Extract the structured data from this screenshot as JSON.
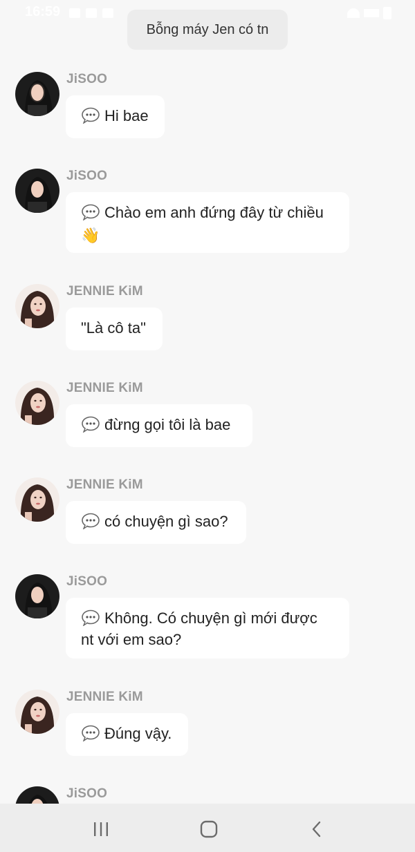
{
  "status_bar": {
    "time": "16:59"
  },
  "chat": {
    "title": "Bỗng máy Jen có tn"
  },
  "messages": [
    {
      "sender": "JiSOO",
      "text": "Hi bae",
      "typing_icon": true,
      "emoji": ""
    },
    {
      "sender": "JiSOO",
      "text": "Chào em anh đứng đây từ chiều",
      "typing_icon": true,
      "emoji": "👋"
    },
    {
      "sender": "JENNIE KiM",
      "text": "\"Là cô ta\"",
      "typing_icon": false,
      "emoji": ""
    },
    {
      "sender": "JENNIE KiM",
      "text": "đừng gọi tôi là bae",
      "typing_icon": true,
      "emoji": ""
    },
    {
      "sender": "JENNIE KiM",
      "text": "có chuyện gì sao?",
      "typing_icon": true,
      "emoji": ""
    },
    {
      "sender": "JiSOO",
      "text": "Không. Có chuyện gì mới được nt với em sao?",
      "typing_icon": true,
      "emoji": ""
    },
    {
      "sender": "JENNIE KiM",
      "text": "Đúng vậy.",
      "typing_icon": true,
      "emoji": ""
    },
    {
      "sender": "JiSOO",
      "text": "",
      "typing_icon": false,
      "emoji": ""
    }
  ],
  "navigation": {
    "recents_icon": "recents-icon",
    "home_icon": "home-icon",
    "back_icon": "back-icon"
  },
  "colors": {
    "background": "#f7f7f7",
    "bubble": "#ffffff",
    "header_pill": "#ececec",
    "sender_name": "#9a9a9a",
    "nav_bar": "#ededed"
  }
}
